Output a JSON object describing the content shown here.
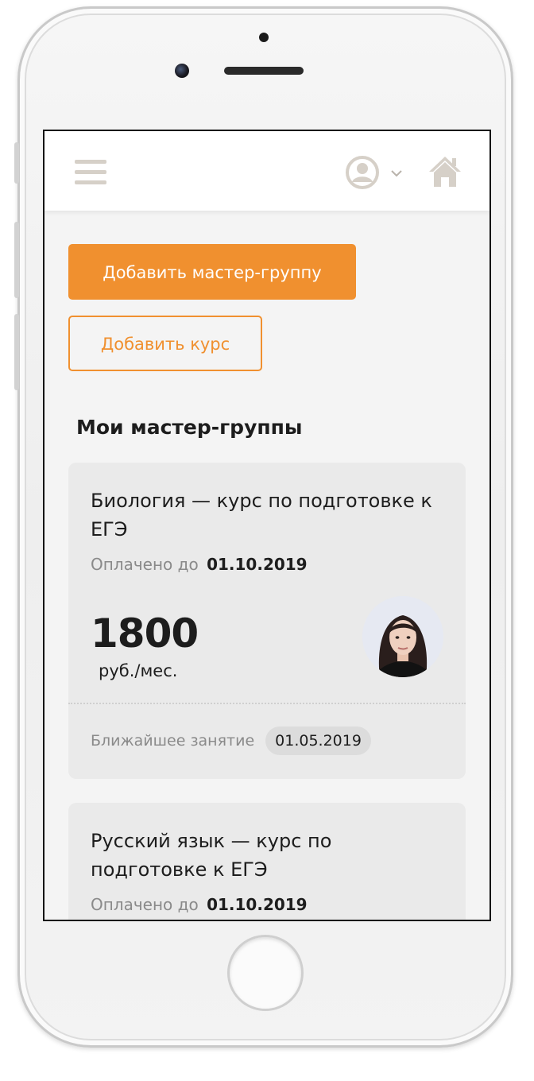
{
  "header": {
    "menu_icon": "hamburger-menu-icon",
    "user_icon": "user-avatar-icon",
    "dropdown_icon": "chevron-down-icon",
    "home_icon": "home-icon"
  },
  "actions": {
    "add_group_label": "Добавить мастер-группу",
    "add_course_label": "Добавить курс"
  },
  "section": {
    "title": "Мои мастер-группы"
  },
  "cards": [
    {
      "title": "Биология — курс по подготовке к ЕГЭ",
      "paid_label": "Оплачено до",
      "paid_date": "01.10.2019",
      "price": "1800",
      "price_unit": "руб./мес.",
      "next_label": "Ближайшее занятие",
      "next_date": "01.05.2019"
    },
    {
      "title": "Русский язык — курс по подготовке к ЕГЭ",
      "paid_label": "Оплачено до",
      "paid_date": "01.10.2019"
    }
  ],
  "colors": {
    "accent": "#f0902f",
    "card_bg": "#eaeaea",
    "screen_bg": "#f4f4f4",
    "icon_muted": "#d6d0c8"
  }
}
